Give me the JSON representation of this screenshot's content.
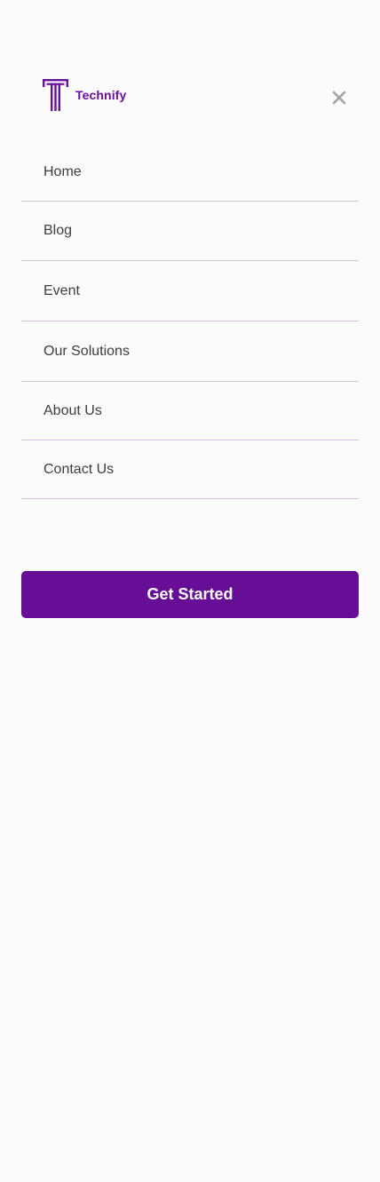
{
  "brand": {
    "name": "Technify",
    "logo_icon": "technify-t-logo-icon",
    "color": "#6a0f99"
  },
  "header": {
    "close_icon": "close-icon"
  },
  "nav": {
    "items": [
      {
        "label": "Home"
      },
      {
        "label": "Blog"
      },
      {
        "label": "Event"
      },
      {
        "label": "Our Solutions"
      },
      {
        "label": "About Us"
      },
      {
        "label": "Contact Us"
      }
    ],
    "divider_color": "#cfc3e0"
  },
  "cta": {
    "label": "Get Started",
    "color": "#660e96"
  }
}
